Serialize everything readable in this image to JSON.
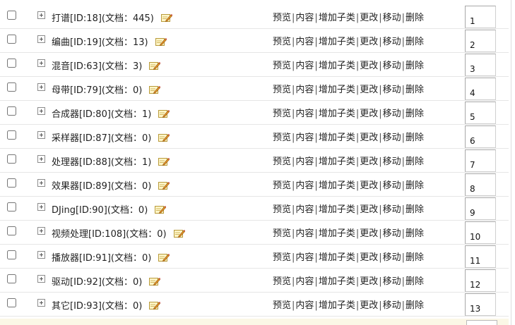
{
  "rows": [
    {
      "name": "打谱[ID:18](文档：445)",
      "order": "1"
    },
    {
      "name": "编曲[ID:19](文档：13)",
      "order": "2"
    },
    {
      "name": "混音[ID:63](文档：3)",
      "order": "3"
    },
    {
      "name": "母带[ID:79](文档：0)",
      "order": "4"
    },
    {
      "name": "合成器[ID:80](文档：1)",
      "order": "5"
    },
    {
      "name": "采样器[ID:87](文档：0)",
      "order": "6"
    },
    {
      "name": "处理器[ID:88](文档：1)",
      "order": "7"
    },
    {
      "name": "效果器[ID:89](文档：0)",
      "order": "8"
    },
    {
      "name": "DJing[ID:90](文档：0)",
      "order": "9"
    },
    {
      "name": "视频处理[ID:108](文档：0)",
      "order": "10"
    },
    {
      "name": "播放器[ID:91](文档：0)",
      "order": "11"
    },
    {
      "name": "驱动[ID:92](文档：0)",
      "order": "12"
    },
    {
      "name": "其它[ID:93](文档：0)",
      "order": "13"
    }
  ],
  "actions": {
    "preview": "预览",
    "content": "内容",
    "add_child": "增加子类",
    "edit": "更改",
    "move": "移动",
    "delete": "删除",
    "separator": "|"
  },
  "icons": {
    "expand": "expand-plus-icon",
    "edit": "edit-pencil-icon"
  },
  "colors": {
    "row_border": "#e6e6e6",
    "footer_bg": "#fbf7e6"
  }
}
